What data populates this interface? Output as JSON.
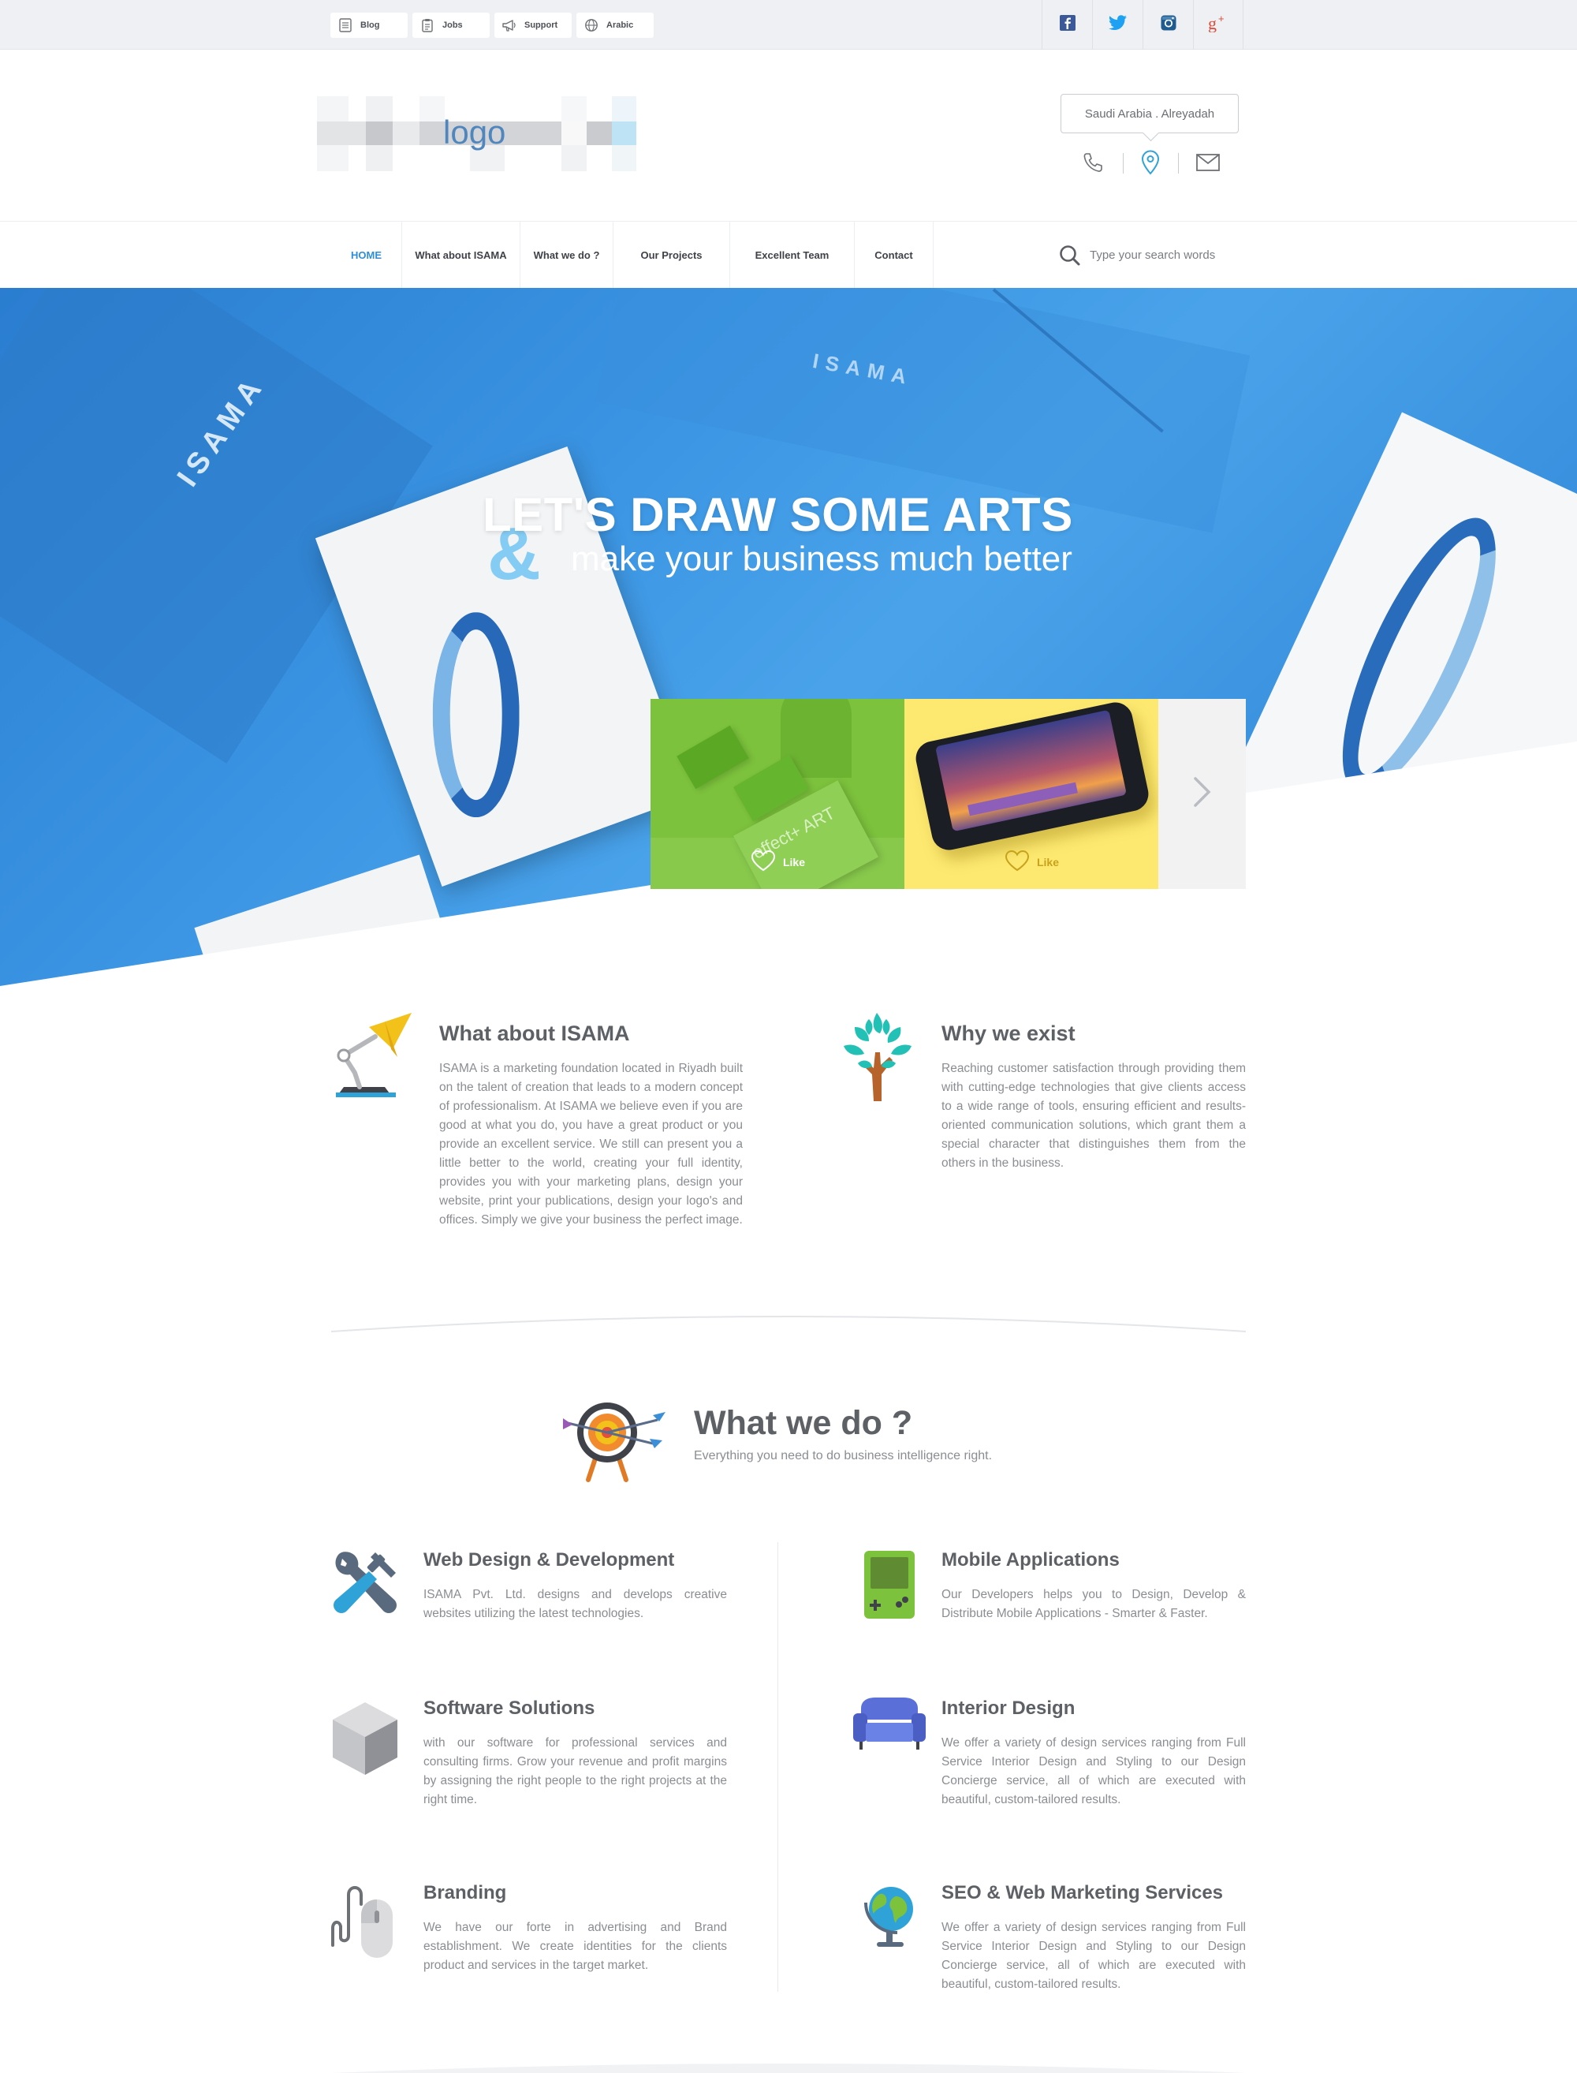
{
  "topbar": {
    "links": [
      {
        "label": "Blog",
        "icon": "document-icon"
      },
      {
        "label": "Jobs",
        "icon": "clipboard-icon"
      },
      {
        "label": "Support",
        "icon": "megaphone-icon"
      },
      {
        "label": "Arabic",
        "icon": "globe-icon"
      }
    ],
    "social": [
      {
        "name": "facebook",
        "color": "#3b5998"
      },
      {
        "name": "twitter",
        "color": "#1da1f2"
      },
      {
        "name": "instagram",
        "color": "#1f5c8f"
      },
      {
        "name": "google-plus",
        "color": "#dd4b39"
      }
    ]
  },
  "header": {
    "logo_text": "logo",
    "location": "Saudi Arabia . Alreyadah"
  },
  "nav": {
    "items": [
      "HOME",
      "What about ISAMA",
      "What we do ?",
      "Our Projects",
      "Excellent Team",
      "Contact"
    ],
    "active_index": 0,
    "search_placeholder": "Type your search words",
    "accent": "#2f8ed8"
  },
  "hero": {
    "title": "LET'S DRAW SOME ARTS",
    "ampersand": "&",
    "subtitle": "make your business much better",
    "card_brand": "ISAMA",
    "slides": [
      {
        "like_label": "Like",
        "bg": "#7cc23c",
        "print_text": "effect+ ART",
        "card_text": "effect+ART"
      },
      {
        "like_label": "Like",
        "bg": "#fde970"
      }
    ]
  },
  "about": {
    "isama": {
      "title": "What about ISAMA",
      "text": "ISAMA is a marketing foundation located in Riyadh built on the talent of creation that leads to a modern concept of professionalism. At ISAMA we believe even if you are good at what you do, you have a great product or you provide an excellent service. We still can present you a little better to the world, creating your full identity, provides you with your marketing plans, design your website, print your publications, design your logo's and offices. Simply we give your business the perfect image."
    },
    "why": {
      "title": "Why we exist",
      "text": "Reaching customer satisfaction through providing them with cutting-edge technologies that give clients access to a wide range of tools, ensuring efficient and results-oriented communication solutions, which grant them a special character that distinguishes them from the others in the business."
    }
  },
  "what_we_do": {
    "title": "What we do ?",
    "subtitle": "Everything you need to do business intelligence right.",
    "services": [
      {
        "title": "Web Design & Development",
        "text": "ISAMA Pvt. Ltd. designs and develops creative websites utilizing the latest technologies.",
        "icon": "tools-icon"
      },
      {
        "title": "Mobile Applications",
        "text": "Our Developers helps you to Design, Develop & Distribute Mobile Applications - Smarter & Faster.",
        "icon": "gameboy-icon"
      },
      {
        "title": "Software Solutions",
        "text": "with our software for professional services and consulting firms. Grow your revenue and profit margins by assigning the right people to the right projects at the right time.",
        "icon": "cube-icon"
      },
      {
        "title": "Interior Design",
        "text": "We offer a variety of design services ranging from Full Service Interior Design and Styling to our Design Concierge service, all of which are executed with beautiful, custom-tailored results.",
        "icon": "sofa-icon"
      },
      {
        "title": "Branding",
        "text": "We have our forte in advertising and Brand establishment. We create identities for the clients product and services in the target market.",
        "icon": "mouse-icon"
      },
      {
        "title": "SEO & Web Marketing Services",
        "text": "We offer a variety of design services ranging from Full Service Interior Design and Styling to our Design Concierge service, all of which are executed with beautiful, custom-tailored results.",
        "icon": "globe-icon"
      }
    ]
  }
}
